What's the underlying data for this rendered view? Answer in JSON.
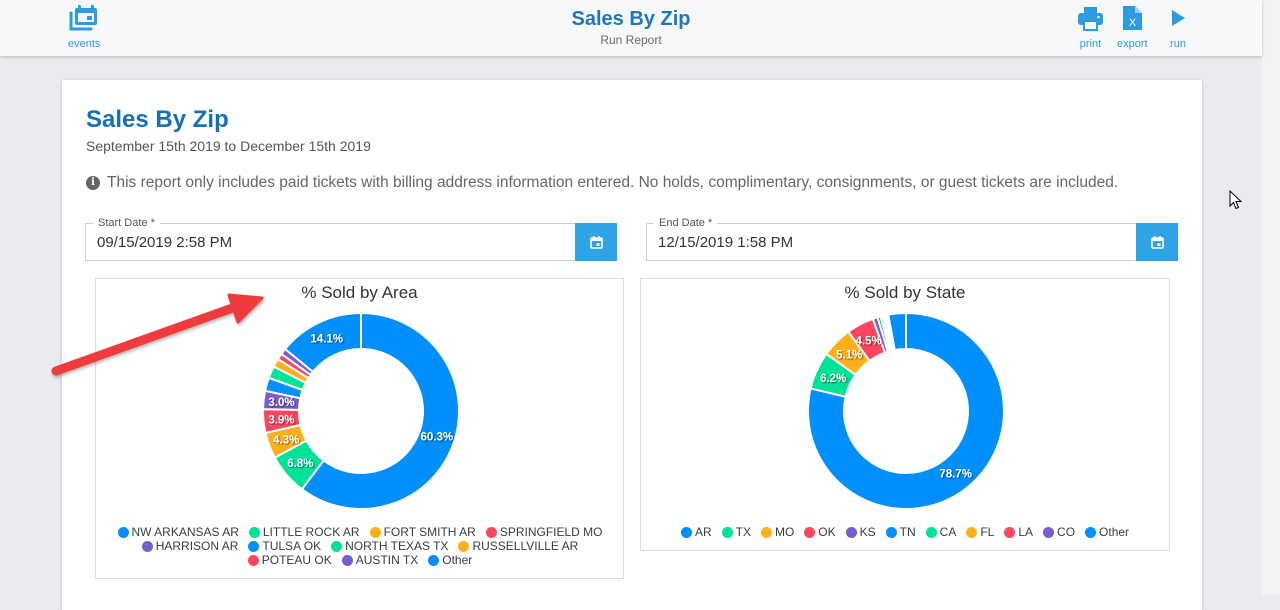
{
  "header": {
    "title": "Sales By Zip",
    "subtitle": "Run Report",
    "left_actions": [
      {
        "label": "events",
        "icon": "calendar-multiple-icon"
      }
    ],
    "right_actions": [
      {
        "label": "print",
        "icon": "printer-icon"
      },
      {
        "label": "export",
        "icon": "excel-file-icon"
      },
      {
        "label": "run",
        "icon": "play-icon"
      }
    ]
  },
  "report": {
    "title": "Sales By Zip",
    "date_range": "September 15th 2019 to December 15th 2019",
    "notice_icon": "info-circle-icon",
    "notice": "This report only includes paid tickets with billing address information entered. No holds, complimentary, consignments, or guest tickets are included."
  },
  "filters": {
    "start_date": {
      "label": "Start Date *",
      "value": "09/15/2019 2:58 PM",
      "button_icon": "calendar-icon"
    },
    "end_date": {
      "label": "End Date *",
      "value": "12/15/2019 1:58 PM",
      "button_icon": "calendar-icon"
    }
  },
  "colors": {
    "accent": "#2ea3e6",
    "title": "#1570b8",
    "annotation_arrow": "#e8363b",
    "palette": [
      "#008FFB",
      "#00E396",
      "#FEB019",
      "#FF4560",
      "#775DD0"
    ]
  },
  "chart_data": [
    {
      "type": "pie",
      "variant": "donut",
      "title": "% Sold by Area",
      "categories": [
        "NW ARKANSAS AR",
        "LITTLE ROCK AR",
        "FORT SMITH AR",
        "SPRINGFIELD MO",
        "HARRISON AR",
        "TULSA OK",
        "NORTH TEXAS TX",
        "RUSSELLVILLE AR",
        "POTEAU OK",
        "AUSTIN TX",
        "Other"
      ],
      "values": [
        60.3,
        6.8,
        4.3,
        3.9,
        3.0,
        2.2,
        2.0,
        1.4,
        1.0,
        1.0,
        14.1
      ],
      "data_labels": [
        "60.3%",
        "6.8%",
        "4.3%",
        "3.9%",
        "3.0%",
        "",
        "",
        "",
        "",
        "",
        "14.1%"
      ],
      "colors": [
        "#008FFB",
        "#00E396",
        "#FEB019",
        "#FF4560",
        "#775DD0",
        "#008FFB",
        "#00E396",
        "#FEB019",
        "#FF4560",
        "#775DD0",
        "#008FFB"
      ],
      "legend": "bottom",
      "unit": "%"
    },
    {
      "type": "pie",
      "variant": "donut",
      "title": "% Sold by State",
      "categories": [
        "AR",
        "TX",
        "MO",
        "OK",
        "KS",
        "TN",
        "CA",
        "FL",
        "LA",
        "CO",
        "Other"
      ],
      "values": [
        78.7,
        6.2,
        5.1,
        4.5,
        0.8,
        0.5,
        0.4,
        0.3,
        0.3,
        0.3,
        2.9
      ],
      "data_labels": [
        "78.7%",
        "6.2%",
        "5.1%",
        "4.5%",
        "",
        "",
        "",
        "",
        "",
        "",
        ""
      ],
      "colors": [
        "#008FFB",
        "#00E396",
        "#FEB019",
        "#FF4560",
        "#775DD0",
        "#008FFB",
        "#00E396",
        "#FEB019",
        "#FF4560",
        "#775DD0",
        "#008FFB"
      ],
      "legend": "bottom",
      "unit": "%"
    }
  ]
}
